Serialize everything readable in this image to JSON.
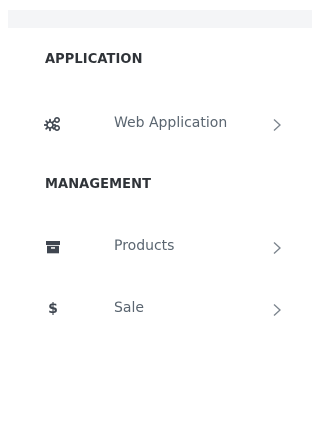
{
  "sections": [
    {
      "heading": "APPLICATION"
    },
    {
      "heading": "MANAGEMENT"
    }
  ],
  "items": [
    {
      "label": "Web Application",
      "icon": "gears-icon"
    },
    {
      "label": "Products",
      "icon": "archive-box-icon"
    },
    {
      "label": "Sale",
      "icon": "dollar-icon",
      "glyph": "$"
    }
  ],
  "colors": {
    "heading": "#2f3338",
    "label": "#5a6570",
    "icon": "#3f4650",
    "chevron": "#7a838c",
    "topbar": "#f4f5f7"
  }
}
